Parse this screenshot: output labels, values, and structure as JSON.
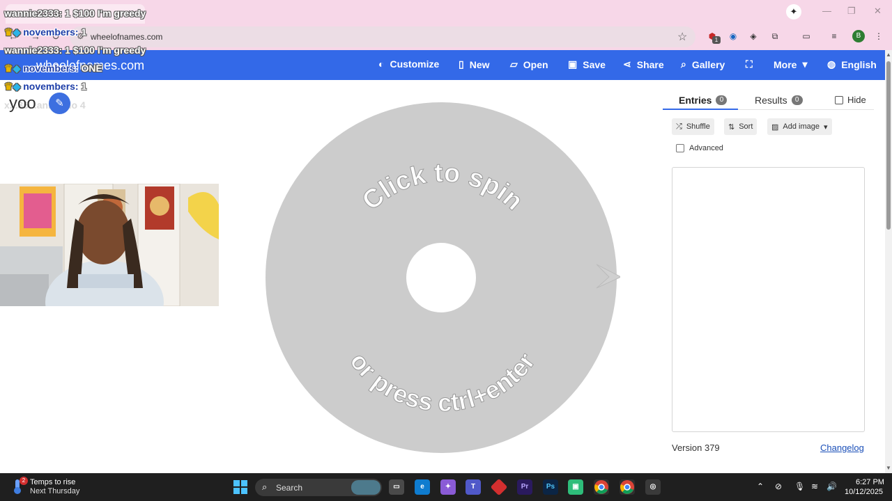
{
  "browser": {
    "url": "wheelofnames.com",
    "tab_close": "×",
    "profile_initial": "B",
    "extension_badge": "1"
  },
  "site": {
    "logo_text": "wheelofnames.com",
    "nav": [
      {
        "label": "Customize",
        "icon": "palette-icon",
        "glyph": "🎨"
      },
      {
        "label": "New",
        "icon": "file-icon",
        "glyph": "🗋"
      },
      {
        "label": "Open",
        "icon": "folder-open-icon",
        "glyph": "📂"
      },
      {
        "label": "Save",
        "icon": "floppy-icon",
        "glyph": "💾"
      },
      {
        "label": "Share",
        "icon": "share-icon",
        "glyph": "⤴"
      },
      {
        "label": "Gallery",
        "icon": "search-icon",
        "glyph": "⌕"
      },
      {
        "label": "More",
        "icon": "chevron-down-icon",
        "glyph": "▾"
      },
      {
        "label": "English",
        "icon": "globe-icon",
        "glyph": "🌐"
      }
    ],
    "accent_color": "#3369e8"
  },
  "wheel": {
    "top_text": "Click to spin",
    "bottom_text": "or press ctrl+enter",
    "color": "#cccccc"
  },
  "panel": {
    "tabs": [
      {
        "label": "Entries",
        "count": "0"
      },
      {
        "label": "Results",
        "count": "0"
      }
    ],
    "hide_label": "Hide",
    "buttons": {
      "shuffle": "Shuffle",
      "sort": "Sort",
      "add_image": "Add image"
    },
    "advanced_label": "Advanced",
    "version": "Version 379",
    "changelog": "Changelog"
  },
  "overlay": {
    "chat": [
      {
        "text": "wannie2333: 1 $100 I'm greedy"
      },
      {
        "name": "novembers:",
        "text": "1"
      },
      {
        "text": "wannie2333: 1 $100 I'm greedy"
      },
      {
        "name": "novembers:",
        "text": "ONE"
      },
      {
        "name": "novembers:",
        "text": "1"
      }
    ],
    "ghost_line": "x...35...anny: do 4",
    "editable_text": "yoo"
  },
  "taskbar": {
    "weather_line1": "Temps to rise",
    "weather_line2": "Next Thursday",
    "weather_badge": "2",
    "search_placeholder": "Search",
    "time": "6:27 PM",
    "date": "10/12/2025"
  }
}
